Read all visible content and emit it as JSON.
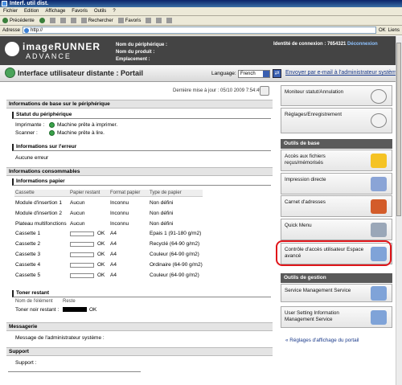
{
  "window": {
    "title": "Interf. util dist."
  },
  "menu": [
    "Fichier",
    "Edition",
    "Affichage",
    "Favoris",
    "Outils",
    "?"
  ],
  "toolbar": {
    "back": "Précédente",
    "search": "Rechercher",
    "favorites": "Favoris"
  },
  "address": {
    "label": "Adresse",
    "value": "http://",
    "go": "OK",
    "links": "Liens"
  },
  "header": {
    "brand": "imageRUNNER",
    "brand_sub": "ADVANCE",
    "device_name_label": "Nom du périphérique :",
    "product_name_label": "Nom du produit :",
    "location_label": "Emplacement :",
    "connection": "Identité de connexion : 7654321",
    "logout": "Déconnexion"
  },
  "portal": {
    "title": "Interface utilisateur distante : Portail",
    "language_label": "Language:",
    "language_value": "French",
    "mail_link": "Envoyer par e-mail à l'administrateur système"
  },
  "main": {
    "last_update": "Dernière mise à jour : 05/10 2009 7:54:49",
    "basic_info": "Informations de base sur le périphérique",
    "device_status": "Statut du périphérique",
    "printer_label": "Imprimante :",
    "printer_status": "Machine prête à imprimer.",
    "scanner_label": "Scanner :",
    "scanner_status": "Machine prête à lire.",
    "error_info": "Informations sur l'erreur",
    "error_value": "Aucune erreur",
    "consumables": "Informations consommables",
    "paper_info": "Informations papier",
    "paper_headers": [
      "Cassette",
      "Papier restant",
      "Format papier",
      "Type de papier"
    ],
    "paper_rows": [
      {
        "cassette": "Module d'insertion 1",
        "remaining": "Aucun",
        "format": "Inconnu",
        "type": "Non défini"
      },
      {
        "cassette": "Module d'insertion 2",
        "remaining": "Aucun",
        "format": "Inconnu",
        "type": "Non défini"
      },
      {
        "cassette": "Plateau multifonctions",
        "remaining": "Aucun",
        "format": "Inconnu",
        "type": "Non défini"
      },
      {
        "cassette": "Cassette 1",
        "remaining": "OK",
        "format": "A4",
        "type": "Epais 1 (91-180 g/m2)"
      },
      {
        "cassette": "Cassette 2",
        "remaining": "OK",
        "format": "A4",
        "type": "Recyclé (64-90 g/m2)"
      },
      {
        "cassette": "Cassette 3",
        "remaining": "OK",
        "format": "A4",
        "type": "Couleur (64-90 g/m2)"
      },
      {
        "cassette": "Cassette 4",
        "remaining": "OK",
        "format": "A4",
        "type": "Ordinaire (64-90 g/m2)"
      },
      {
        "cassette": "Cassette 5",
        "remaining": "OK",
        "format": "A4",
        "type": "Couleur (64-90 g/m2)"
      }
    ],
    "toner": "Toner restant",
    "toner_name_header": "Nom de l'élément",
    "toner_rest_header": "Reste",
    "toner_label": "Toner noir restant :",
    "toner_value": "OK",
    "messaging": "Messagerie",
    "admin_message_label": "Message de l'administrateur système :",
    "support": "Support",
    "support_label": "Support :"
  },
  "sidebar": {
    "status_monitor": "Moniteur statut/Annulation",
    "settings": "Réglages/Enregistrement",
    "basic_tools": "Outils de base",
    "received_files": "Accès aux fichiers reçus/mémorisés",
    "direct_print": "Impression directe",
    "address_book": "Carnet d'adresses",
    "quick_menu": "Quick Menu",
    "access_control": "Contrôle d'accès utilisateur Espace avancé",
    "admin_tools": "Outils de gestion",
    "service_mgmt": "Service Management Service",
    "user_setting": "User Setting Information Management Service",
    "portal_settings": "Réglages d'affichage du portail"
  }
}
